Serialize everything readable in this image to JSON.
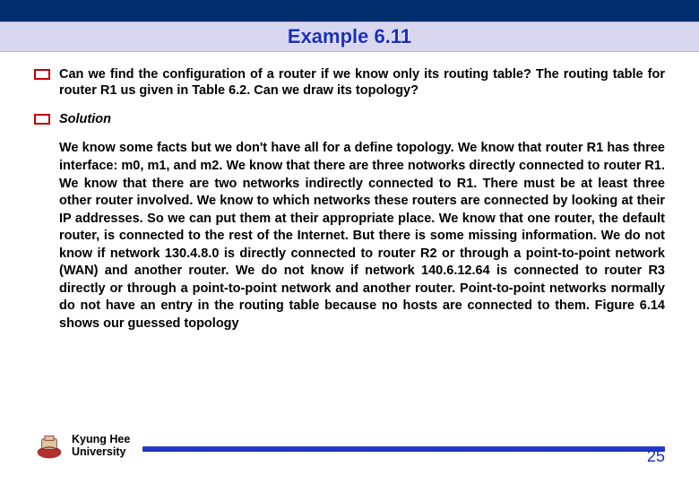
{
  "title": "Example 6.11",
  "bullets": {
    "question": "Can we find the configuration of a router if we know only its routing table? The routing table for router R1 us given in Table 6.2. Can we draw its topology?",
    "solution_label": "Solution"
  },
  "body": "We know some facts but we don't have all for a define topology. We know that router R1 has three interface: m0, m1, and m2. We know that there are three notworks directly connected to router R1. We know that there are two networks indirectly connected to R1. There must be at least three other router involved. We know to which networks these routers are connected by looking at their IP addresses. So we can put them at their appropriate place.  We know that one router, the default router, is connected to the rest of the Internet. But there is some missing information. We do not know if network 130.4.8.0 is directly connected to router R2 or through a point-to-point network (WAN) and another router. We do not know if network 140.6.12.64 is connected to router R3 directly or through a point-to-point network and another router. Point-to-point networks normally do not have an entry in the routing table because no hosts are connected to them. Figure 6.14 shows our guessed topology",
  "footer": {
    "university_line1": "Kyung Hee",
    "university_line2": "University",
    "page_number": "25"
  }
}
